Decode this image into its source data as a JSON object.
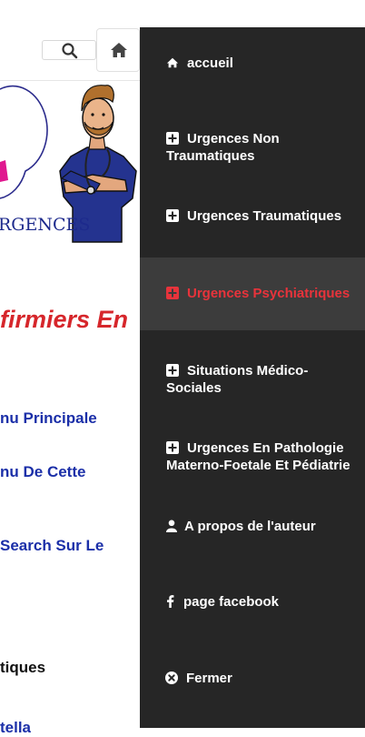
{
  "background": {
    "logo_text": "RGENCES",
    "heading": "firmiers En",
    "links": [
      "nu Principale",
      "nu De Cette",
      "Search Sur Le"
    ],
    "partial_text": [
      "tiques",
      "tella"
    ]
  },
  "drawer": {
    "items": [
      {
        "label": "accueil",
        "icon": "home-icon",
        "active": false
      },
      {
        "label": "Urgences Non Traumatiques",
        "icon": "plus-square-icon",
        "active": false
      },
      {
        "label": "Urgences Traumatiques",
        "icon": "plus-square-icon",
        "active": false
      },
      {
        "label": "Urgences Psychiatriques",
        "icon": "plus-square-icon",
        "active": true
      },
      {
        "label": "Situations Médico-Sociales",
        "icon": "plus-square-icon",
        "active": false
      },
      {
        "label": "Urgences En Pathologie Materno-Foetale Et Pédiatrie",
        "icon": "plus-square-icon",
        "active": false
      },
      {
        "label": "A propos de l'auteur",
        "icon": "user-icon",
        "active": false
      },
      {
        "label": "page facebook",
        "icon": "facebook-icon",
        "active": false
      },
      {
        "label": "Fermer",
        "icon": "close-circle-icon",
        "active": false
      }
    ]
  },
  "colors": {
    "drawer_bg": "#262626",
    "active_bg": "#3c3c3c",
    "active_text": "#e8333b",
    "link_blue": "#1b2fa8",
    "heading_red": "#d6262b"
  }
}
